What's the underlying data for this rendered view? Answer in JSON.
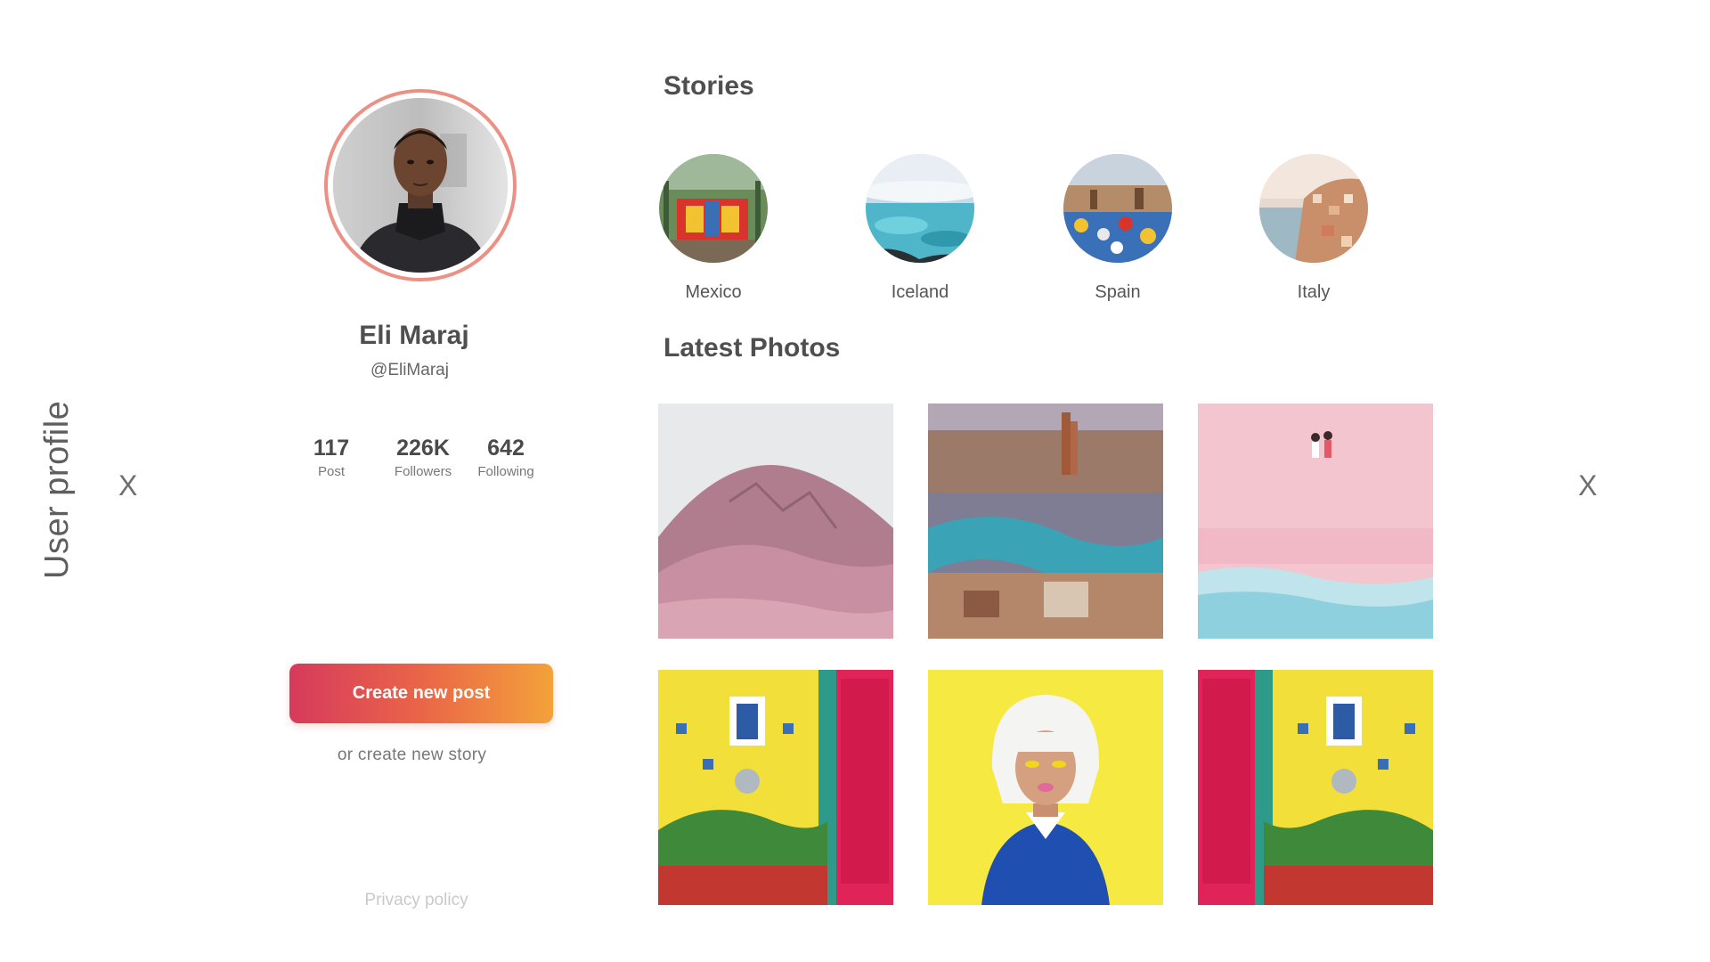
{
  "sidebar": {
    "title": "User profile",
    "close_left": "X",
    "close_right": "X"
  },
  "profile": {
    "name": "Eli Maraj",
    "handle": "@EliMaraj",
    "avatar_icon": "user-avatar-photo",
    "ring_color": "#ec8f84",
    "stats": [
      {
        "value": "117",
        "label": "Post"
      },
      {
        "value": "226K",
        "label": "Followers"
      },
      {
        "value": "642",
        "label": "Following"
      }
    ],
    "create_post_label": "Create new post",
    "create_story_label": "or create new story",
    "privacy_label": "Privacy policy",
    "button_gradient": [
      "#d63a5c",
      "#f3a23a"
    ]
  },
  "stories": {
    "title": "Stories",
    "items": [
      {
        "label": "Mexico"
      },
      {
        "label": "Iceland"
      },
      {
        "label": "Spain"
      },
      {
        "label": "Italy"
      }
    ]
  },
  "photos": {
    "title": "Latest Photos",
    "items": [
      {
        "name": "pink-mountain-photo"
      },
      {
        "name": "river-city-photo"
      },
      {
        "name": "pink-beach-photo"
      },
      {
        "name": "yellow-wall-red-door-photo"
      },
      {
        "name": "white-hair-portrait-photo"
      },
      {
        "name": "red-door-yellow-wall-photo"
      }
    ]
  }
}
